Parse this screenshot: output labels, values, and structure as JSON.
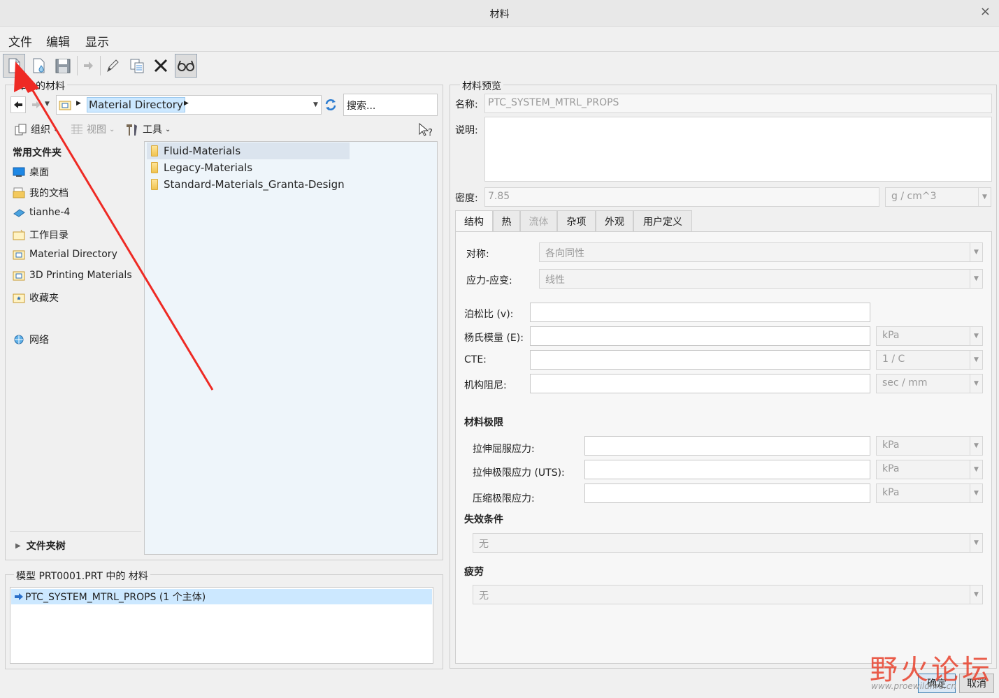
{
  "window": {
    "title": "材料",
    "close": "×"
  },
  "menu": [
    "文件",
    "编辑",
    "显示"
  ],
  "library": {
    "group_label": "库中的材料",
    "path": "Material Directory",
    "search_placeholder": "搜索...",
    "organize": "组织",
    "view": "视图",
    "tools": "工具",
    "common_header": "常用文件夹",
    "common_folders": [
      "桌面",
      "我的文档",
      "tianhe-4",
      "工作目录",
      "Material Directory",
      "3D Printing Materials",
      "收藏夹"
    ],
    "network": "网络",
    "folder_tree": "文件夹树",
    "files": [
      "Fluid-Materials",
      "Legacy-Materials",
      "Standard-Materials_Granta-Design"
    ]
  },
  "model": {
    "group_label": "模型 PRT0001.PRT 中的 材料",
    "items": [
      "PTC_SYSTEM_MTRL_PROPS (1 个主体)"
    ]
  },
  "preview": {
    "group_label": "材料预览",
    "name_label": "名称:",
    "name_value": "PTC_SYSTEM_MTRL_PROPS",
    "desc_label": "说明:",
    "density_label": "密度:",
    "density_value": "7.85",
    "density_unit": "g / cm^3",
    "tabs": [
      "结构",
      "热",
      "流体",
      "杂项",
      "外观",
      "用户定义"
    ],
    "symmetry_label": "对称:",
    "symmetry_value": "各向同性",
    "stress_label": "应力-应变:",
    "stress_value": "线性",
    "poisson_label": "泊松比 (v):",
    "young_label": "杨氏模量 (E):",
    "young_unit": "kPa",
    "cte_label": "CTE:",
    "cte_unit": "1 / C",
    "damping_label": "机构阻尼:",
    "damping_unit": "sec / mm",
    "limits_header": "材料极限",
    "tensile_yield_label": "拉伸屈服应力:",
    "tensile_yield_unit": "kPa",
    "uts_label": "拉伸极限应力 (UTS):",
    "uts_unit": "kPa",
    "compress_label": "压缩极限应力:",
    "compress_unit": "kPa",
    "failure_header": "失效条件",
    "failure_value": "无",
    "fatigue_header": "疲劳",
    "fatigue_value": "无"
  },
  "buttons": {
    "ok": "确定",
    "cancel": "取消"
  },
  "watermark": {
    "text": "野火论坛",
    "url": "www.proewildfire.cn"
  },
  "colors": {
    "selection": "#cce8ff",
    "arrow": "#ee2a24"
  }
}
